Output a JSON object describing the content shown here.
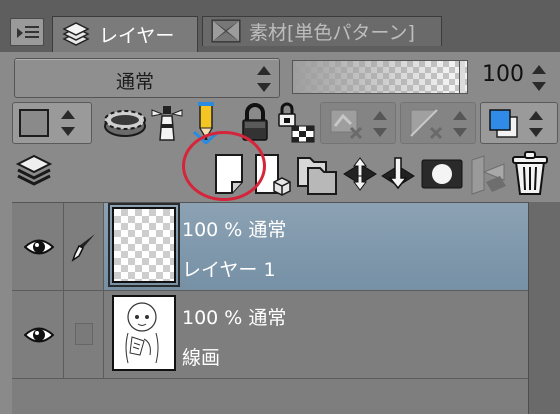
{
  "tabs": {
    "menu_icon": "panel-menu-icon",
    "layer_tab": {
      "label": "レイヤー",
      "icon": "layer-stack-icon"
    },
    "material_tab": {
      "label": "素材[単色パターン]",
      "icon": "material-pattern-icon"
    }
  },
  "blend": {
    "mode": "通常",
    "opacity": "100",
    "opacity_fraction": 1.0
  },
  "toolbar": {
    "icons": [
      "layer-color-swatch-icon",
      "clip-to-layer-below-icon",
      "reference-layer-icon",
      "draft-layer-icon",
      "lock-layer-icon",
      "lock-transparent-pixels-icon",
      "enable-mask-icon",
      "show-ruler-icon",
      "layer-color-icon"
    ]
  },
  "actions": {
    "icons": [
      "layer-property-icon",
      "new-raster-layer-icon",
      "new-vector-layer-icon",
      "new-layer-folder-icon",
      "transfer-to-lower-layer-icon",
      "merge-with-layer-below-icon",
      "create-layer-mask-icon",
      "apply-mask-icon",
      "delete-layer-icon"
    ],
    "highlight_color": "#d6243b"
  },
  "layers": [
    {
      "opacity_mode": "100 % 通常",
      "name": "レイヤー 1",
      "selected": true,
      "editing": true,
      "thumbnail": "transparent"
    },
    {
      "opacity_mode": "100 % 通常",
      "name": "線画",
      "selected": false,
      "editing": false,
      "thumbnail": "line-art-sketch"
    }
  ],
  "colors": {
    "panel_bg": "#8a8a8a",
    "selected_row": "#8ca2b4",
    "accent_blue": "#2f8be6"
  }
}
